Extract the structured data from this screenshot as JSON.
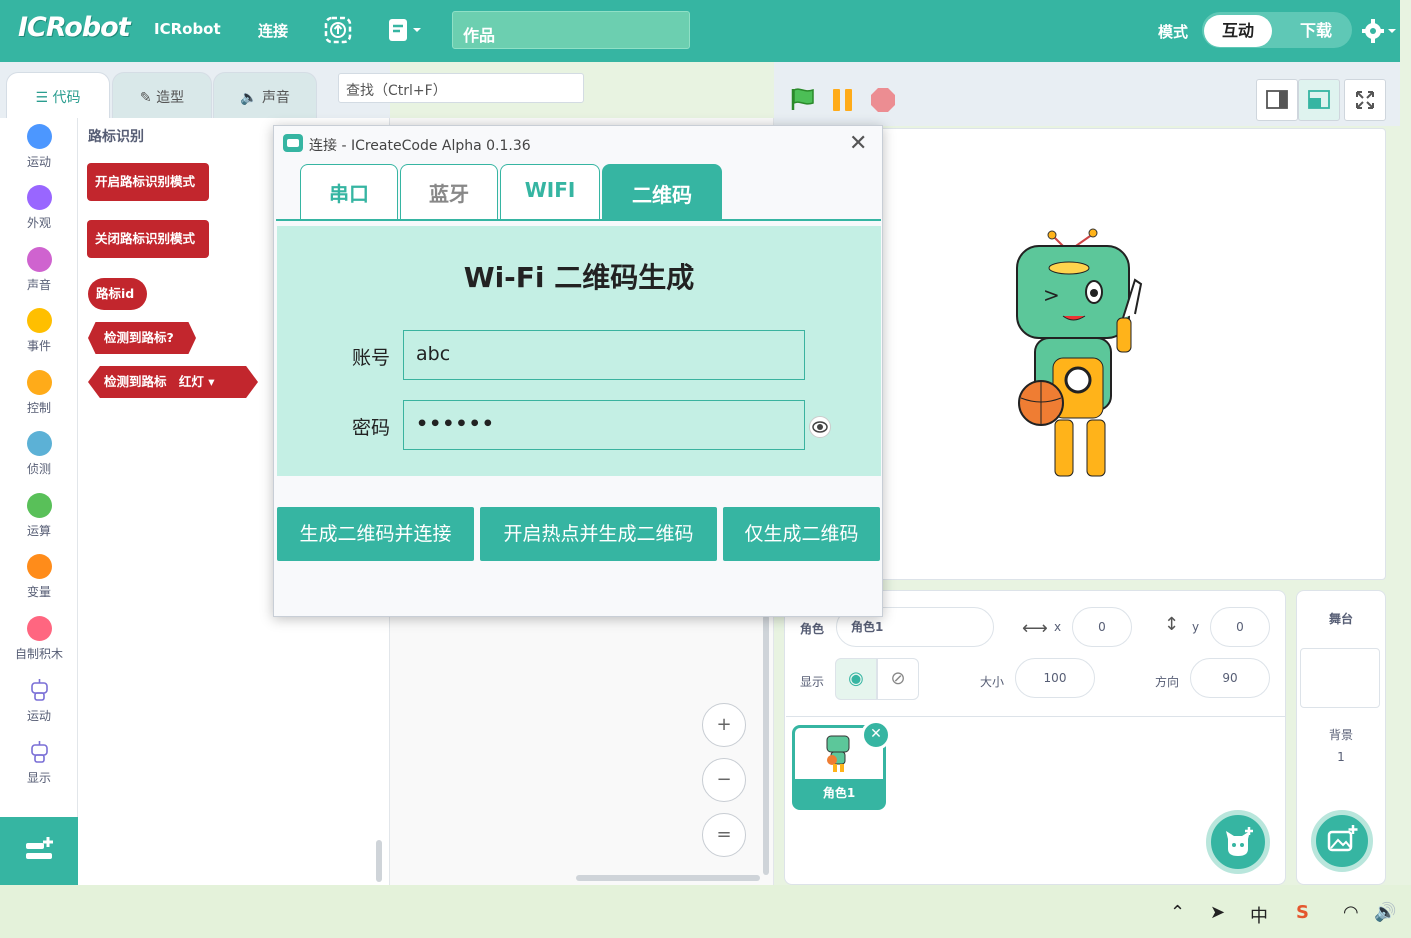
{
  "topbar": {
    "logo": "ICRobot",
    "brand": "ICRobot",
    "connect": "连接",
    "project_title": "作品",
    "mode_label": "模式",
    "mode_interact": "互动",
    "mode_download": "下载",
    "colors": {
      "primary": "#36b5a2",
      "project_field": "#6ccfb0"
    }
  },
  "editor_tabs": {
    "code": "代码",
    "costume": "造型",
    "sound": "声音"
  },
  "search": {
    "placeholder": "查找（Ctrl+F）"
  },
  "categories": [
    {
      "label": "运动",
      "color": "#4c97ff"
    },
    {
      "label": "外观",
      "color": "#9966ff"
    },
    {
      "label": "声音",
      "color": "#cf63cf"
    },
    {
      "label": "事件",
      "color": "#ffbf00"
    },
    {
      "label": "控制",
      "color": "#ffab19"
    },
    {
      "label": "侦测",
      "color": "#5cb1d6"
    },
    {
      "label": "运算",
      "color": "#59c059"
    },
    {
      "label": "变量",
      "color": "#ff8c1a"
    },
    {
      "label": "自制积木",
      "color": "#ff6680"
    },
    {
      "label": "运动",
      "color": "robot-icon"
    },
    {
      "label": "显示",
      "color": "robot-icon"
    }
  ],
  "palette": {
    "title": "路标识别",
    "blocks": {
      "enable": "开启路标识别模式",
      "disable": "关闭路标识别模式",
      "sign_id": "路标id",
      "detected": "检测到路标?",
      "detected_sign": "检测到路标",
      "sign_option": "红灯"
    },
    "block_color": "#c2262d"
  },
  "zoom": {
    "in": "+",
    "out": "−",
    "reset": "="
  },
  "sprite": {
    "label": "角色",
    "name": "角色1",
    "x_label": "x",
    "x": "0",
    "y_label": "y",
    "y": "0",
    "show_label": "显示",
    "size_label": "大小",
    "size": "100",
    "direction_label": "方向",
    "direction": "90",
    "thumb_name": "角色1"
  },
  "stage_panel": {
    "title": "舞台",
    "backdrop_label": "背景",
    "backdrop_count": "1"
  },
  "modal": {
    "title": "连接 - ICreateCode Alpha 0.1.36",
    "tabs": [
      "串口",
      "蓝牙",
      "WIFI",
      "二维码"
    ],
    "active_tab": "二维码",
    "heading": "Wi-Fi 二维码生成",
    "account_label": "账号",
    "account_value": "abc",
    "password_label": "密码",
    "password_value": "••••••",
    "buttons": [
      "生成二维码并连接",
      "开启热点并生成二维码",
      "仅生成二维码"
    ]
  },
  "taskbar": {
    "ime": "中"
  }
}
